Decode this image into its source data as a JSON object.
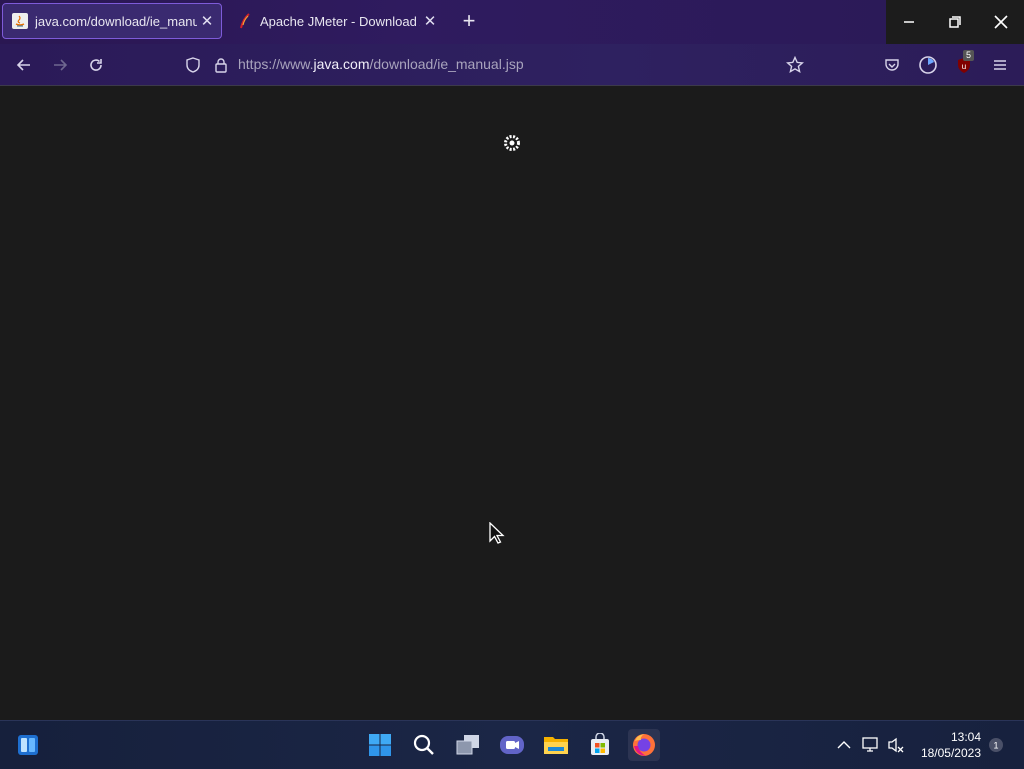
{
  "tabs": [
    {
      "title": "java.com/download/ie_manual",
      "close": "✕",
      "active": true
    },
    {
      "title": "Apache JMeter - Download Apa",
      "close": "✕",
      "active": false
    }
  ],
  "new_tab": "+",
  "window_controls": {
    "minimize": "─",
    "maximize": "❐",
    "close": "✕"
  },
  "address": {
    "prefix": "https://www.",
    "domain": "java.com",
    "path": "/download/ie_manual.jsp"
  },
  "extensions": {
    "ublock_badge": "5"
  },
  "clock": {
    "time": "13:04",
    "date": "18/05/2023"
  },
  "colors": {
    "accent": "#7e5bd9",
    "tabbar": "#2b1a5a",
    "content_bg": "#1b1b1b",
    "taskbar": "#1a2440"
  },
  "icons": [
    "java-favicon",
    "jmeter-feather-icon",
    "back-arrow-icon",
    "forward-arrow-icon",
    "reload-icon",
    "shield-icon",
    "lock-icon",
    "bookmark-star-icon",
    "pocket-icon",
    "timer-icon",
    "ublock-icon",
    "menu-icon",
    "loading-spinner-icon",
    "mouse-cursor-icon",
    "widgets-icon",
    "windows-start-icon",
    "search-icon",
    "task-view-icon",
    "teams-chat-icon",
    "file-explorer-icon",
    "store-icon",
    "firefox-icon",
    "chevron-up-icon",
    "network-icon",
    "volume-muted-icon",
    "notification-icon"
  ]
}
